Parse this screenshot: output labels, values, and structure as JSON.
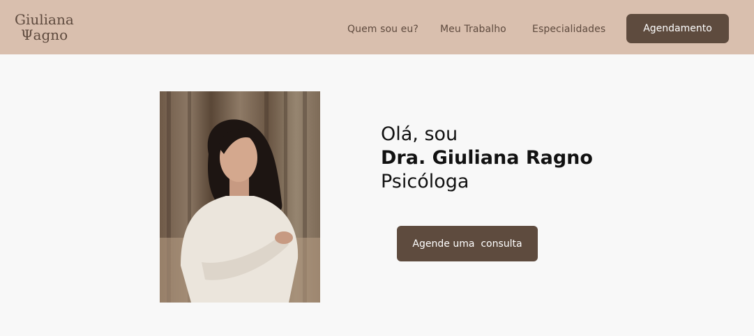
{
  "header": {
    "logo_line1": "Giuliana",
    "logo_line2": "Ψagno",
    "nav": {
      "quem": "Quem sou eu?",
      "trabalho": "Meu Trabalho",
      "especialidades": "Especialidades"
    },
    "cta": "Agendamento"
  },
  "hero": {
    "line1": "Olá, sou",
    "name": "Dra. Giuliana Ragno",
    "role": "Psicóloga",
    "button": "Agende uma  consulta"
  },
  "colors": {
    "header_bg": "#d9bfae",
    "brand_brown": "#5e4b3e",
    "page_bg": "#f8f8f8"
  }
}
